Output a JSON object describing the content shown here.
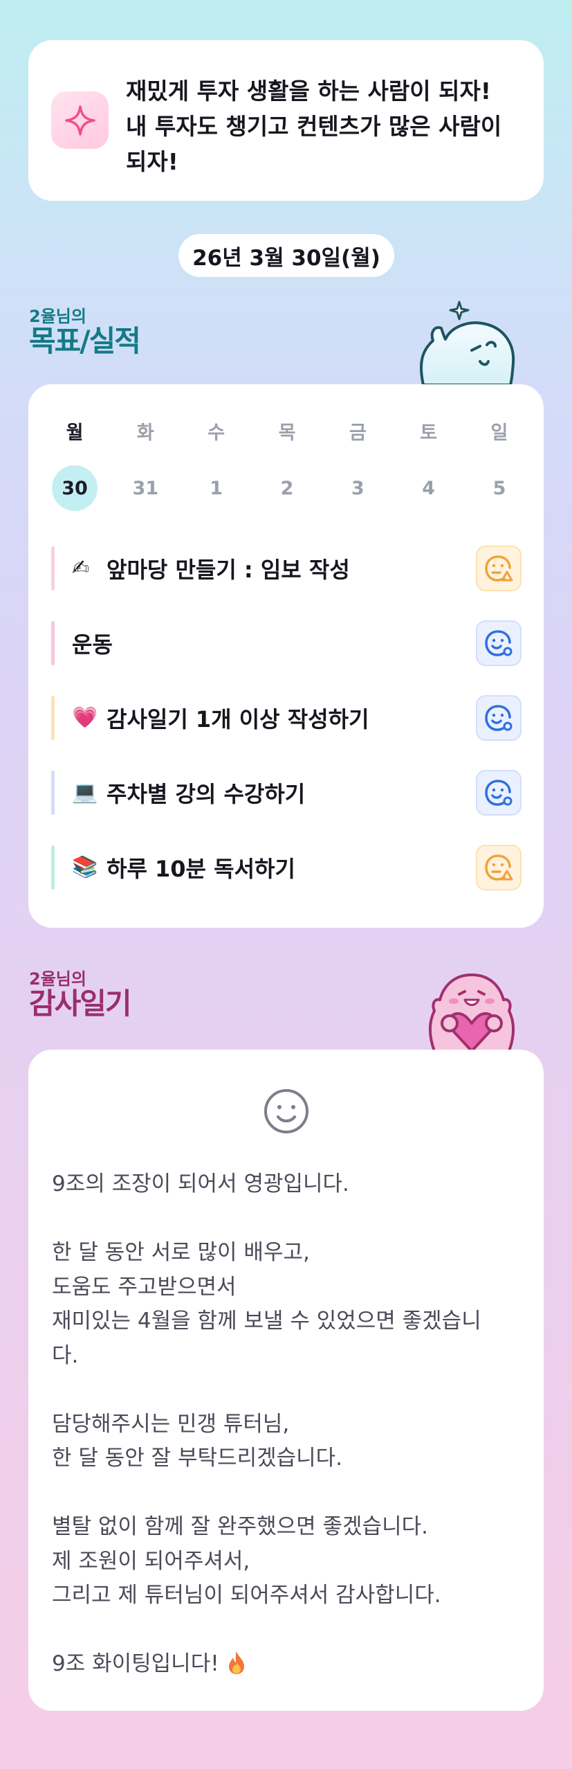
{
  "motto": {
    "icon": "sparkle-icon",
    "text": "재밌게 투자 생활을 하는 사람이 되자! 내 투자도 챙기고 컨텐츠가 많은 사람이 되자!"
  },
  "date_label": "26년 3월 30일(월)",
  "goals_section": {
    "subtitle": "2율님의",
    "title": "목표/실적"
  },
  "week": {
    "days": [
      "월",
      "화",
      "수",
      "목",
      "금",
      "토",
      "일"
    ],
    "dates": [
      "30",
      "31",
      "1",
      "2",
      "3",
      "4",
      "5"
    ],
    "selected_index": 0
  },
  "goals": [
    {
      "emoji": "✍",
      "label": "앞마당 만들기 : 임보 작성",
      "bar_color": "#fbd0dd",
      "status": "warning",
      "status_icon": "face-warning-icon"
    },
    {
      "emoji": "",
      "label": "운동",
      "bar_color": "#f7c6e0",
      "status": "ok",
      "status_icon": "face-ok-icon"
    },
    {
      "emoji": "💗",
      "label": "감사일기 1개 이상 작성하기",
      "bar_color": "#fde2b6",
      "status": "ok",
      "status_icon": "face-ok-icon"
    },
    {
      "emoji": "💻",
      "label": "주차별 강의 수강하기",
      "bar_color": "#d4dcf7",
      "status": "ok",
      "status_icon": "face-ok-icon"
    },
    {
      "emoji": "📚",
      "label": "하루 10분 독서하기",
      "bar_color": "#bfefe0",
      "status": "warning",
      "status_icon": "face-warning-icon"
    }
  ],
  "thanks_section": {
    "subtitle": "2율님의",
    "title": "감사일기"
  },
  "diary": {
    "mood_icon": "smile-face-icon",
    "paragraphs": [
      [
        "9조의 조장이 되어서 영광입니다."
      ],
      [
        "한 달 동안 서로 많이 배우고,",
        "도움도 주고받으면서",
        "재미있는 4월을 함께 보낼 수 있었으면 좋겠습니",
        "다."
      ],
      [
        "담당해주시는 민갱 튜터님,",
        "한 달 동안 잘 부탁드리겠습니다."
      ],
      [
        "별탈 없이 함께 잘 완주했으면 좋겠습니다.",
        "제 조원이 되어주셔서,",
        "그리고 제 튜터님이 되어주셔서 감사합니다."
      ],
      [
        "9조 화이팅입니다!"
      ]
    ],
    "end_icon": "fire-icon"
  },
  "colors": {
    "goals_accent": "#137a86",
    "thanks_accent": "#9a2e6d",
    "today_highlight": "#c3eff2",
    "status_warning": "#f0a23c",
    "status_ok": "#2f6fe0"
  }
}
